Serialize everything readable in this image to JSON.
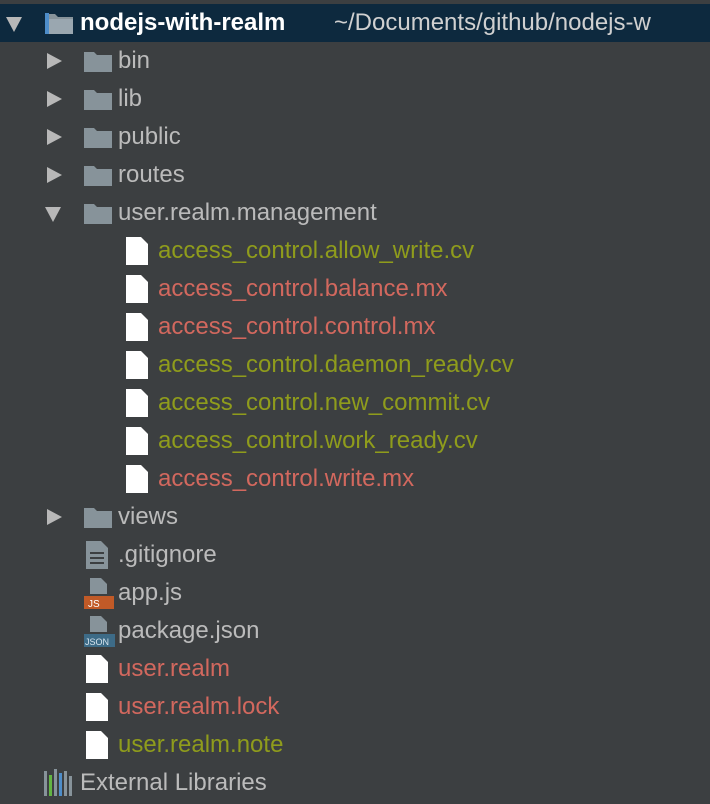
{
  "project": {
    "name": "nodejs-with-realm",
    "path": "~/Documents/github/nodejs-w"
  },
  "colors": {
    "background": "#3c3f41",
    "selected_row": "#0d293e",
    "untracked_red": "#d2685e",
    "ignored_olive": "#8f9c1c",
    "normal_text": "#bbbbbb"
  },
  "tree": {
    "folders": {
      "bin": "bin",
      "lib": "lib",
      "public": "public",
      "routes": "routes",
      "user_realm_management": "user.realm.management",
      "views": "views"
    },
    "management_files": [
      "access_control.allow_write.cv",
      "access_control.balance.mx",
      "access_control.control.mx",
      "access_control.daemon_ready.cv",
      "access_control.new_commit.cv",
      "access_control.work_ready.cv",
      "access_control.write.mx"
    ],
    "root_files": {
      "gitignore": ".gitignore",
      "app_js": "app.js",
      "package_json": "package.json",
      "user_realm": "user.realm",
      "user_realm_lock": "user.realm.lock",
      "user_realm_note": "user.realm.note"
    },
    "file_badges": {
      "js": "JS",
      "json": "JSON"
    },
    "external_libraries": "External Libraries"
  }
}
